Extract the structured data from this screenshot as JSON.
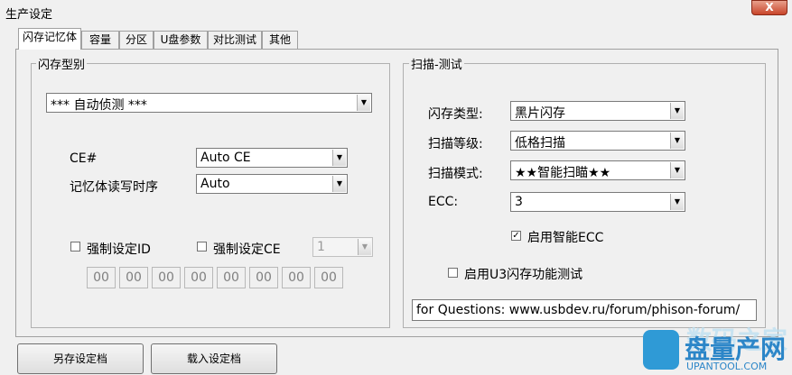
{
  "window": {
    "title": "生产设定",
    "close_label": "X"
  },
  "tabs": [
    {
      "label": "闪存记忆体"
    },
    {
      "label": "容量"
    },
    {
      "label": "分区"
    },
    {
      "label": "U盘参数"
    },
    {
      "label": "对比测试"
    },
    {
      "label": "其他"
    }
  ],
  "flash_type_group": {
    "legend": "闪存型别",
    "detect_select": "*** 自动侦测 ***",
    "ce_label": "CE#",
    "ce_select": "Auto CE",
    "timing_label": "记忆体读写时序",
    "timing_select": "Auto",
    "force_id_label": "强制设定ID",
    "force_ce_label": "强制设定CE",
    "force_ce_value": "1",
    "id_values": [
      "00",
      "00",
      "00",
      "00",
      "00",
      "00",
      "00",
      "00"
    ]
  },
  "scan_group": {
    "legend": "扫描-测试",
    "flash_kind_label": "闪存类型:",
    "flash_kind_value": "黑片闪存",
    "scan_level_label": "扫描等级:",
    "scan_level_value": "低格扫描",
    "scan_mode_label": "扫描模式:",
    "scan_mode_value": "★★智能扫瞄★★",
    "ecc_label": "ECC:",
    "ecc_value": "3",
    "smart_ecc_label": "启用智能ECC",
    "smart_ecc_checked": true,
    "u3_test_label": "启用U3闪存功能测试",
    "u3_test_checked": false,
    "info_text": "for Questions: www.usbdev.ru/forum/phison-forum/"
  },
  "buttons": {
    "save_as": "另存设定档",
    "load": "载入设定档"
  },
  "watermark": {
    "top_text": "数码之家",
    "main_text": "盘量产网",
    "url": "UPANTOOL.COM"
  }
}
